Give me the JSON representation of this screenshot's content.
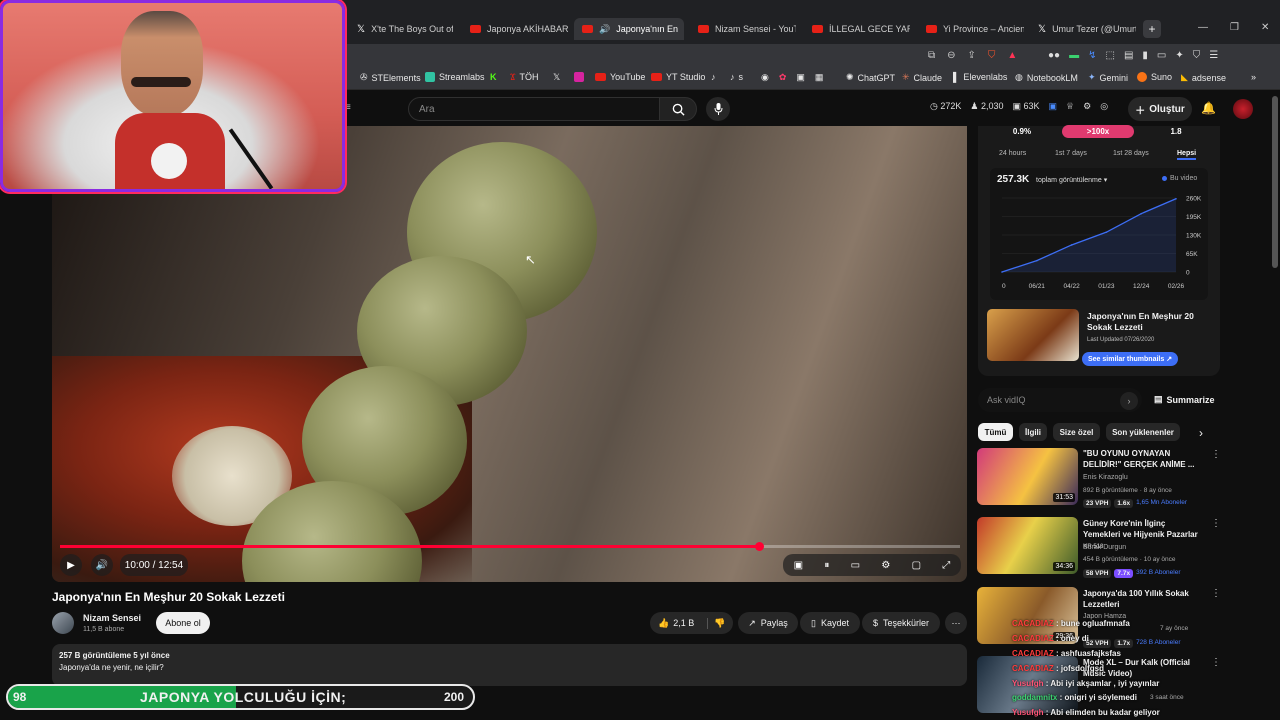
{
  "browser": {
    "tabs": [
      {
        "label": "X'te The Boys Out of C",
        "icon": "x-icon"
      },
      {
        "label": "Japonya AKİHABARA b",
        "icon": "youtube-icon"
      },
      {
        "label": "Japonya'nın En",
        "icon": "youtube-icon",
        "active": true
      },
      {
        "label": "Nizam Sensei - YouTub",
        "icon": "youtube-icon"
      },
      {
        "label": "İLLEGAL GECE YARIŞIN",
        "icon": "youtube-icon"
      },
      {
        "label": "Yi Province – Ancient C",
        "icon": "youtube-icon"
      },
      {
        "label": "Umur Tezer (@Umurte",
        "icon": "x-icon"
      }
    ],
    "new_tab": "+",
    "window_controls": [
      "—",
      "❐",
      "✕"
    ],
    "bookmarks": [
      "STElements",
      "Streamlabs",
      "TÖH",
      "YouTube",
      "YT Studio",
      "s",
      "ChatGPT",
      "Claude",
      "Elevenlabs",
      "NotebookLM",
      "Gemini",
      "Suno",
      "adsense"
    ],
    "more_bookmarks": "»"
  },
  "youtube": {
    "search_placeholder": "Ara",
    "header_stats": {
      "views": "272K",
      "likes": "2,030",
      "subs": "63K"
    },
    "create_label": "Oluştur"
  },
  "video": {
    "time": "10:00 / 12:54",
    "progress": 0.777,
    "title": "Japonya'nın En Meşhur 20 Sokak Lezzeti",
    "channel": "Nizam Sensei",
    "subscribers": "11,5 B abone",
    "subscribe_label": "Abone ol",
    "likes": "2,1 B",
    "share_label": "Paylaş",
    "save_label": "Kaydet",
    "thanks_label": "Teşekkürler",
    "desc_meta": "257 B görüntüleme  5 yıl önce",
    "desc_text": "Japonya'da ne yenir, ne içilir?"
  },
  "vidiq": {
    "stats": [
      "0.9%",
      ">100x",
      "1.8"
    ],
    "ranges": [
      "24 hours",
      "1st 7 days",
      "1st 28 days",
      "Hepsi"
    ],
    "total_views": "257.3K",
    "views_dropdown": "toplam görüntülenme ▾",
    "legend": "Bu video",
    "card_title": "Japonya'nın En Meşhur 20 Sokak Lezzeti",
    "card_updated": "Last Updated 07/26/2020",
    "similar_label": "See similar thumbnails ↗",
    "ask_placeholder": "Ask vidIQ",
    "summarize_label": "Summarize"
  },
  "chart_data": {
    "type": "line",
    "x": [
      "0",
      "06/21",
      "04/22",
      "01/23",
      "12/24",
      "02/26"
    ],
    "ytick_labels": [
      "0",
      "65K",
      "130K",
      "195K",
      "260K"
    ],
    "ylim": [
      0,
      260000
    ],
    "series": [
      {
        "name": "Bu video",
        "values": [
          0,
          40000,
          95000,
          140000,
          205000,
          257300
        ]
      }
    ],
    "color": "#3d6ef5"
  },
  "chips": [
    "Tümü",
    "İlgili",
    "Size özel",
    "Son yüklenenler"
  ],
  "recommendations": [
    {
      "title": "\"BU OYUNU OYNAYAN DELİDİR!\" GERÇEK ANİME ...",
      "channel": "Enis Kirazoglu",
      "meta": "892 B görüntüleme · 8 ay önce",
      "vph": "23 VPH",
      "mult": "1.6x",
      "subs": "1,65 Mn Aboneler",
      "duration": "31:53",
      "colors": [
        "#d23a7a",
        "#f5c242"
      ]
    },
    {
      "title": "Güney Kore'nin İlginç Yemekleri ve Hijyenik Pazarlar",
      "ep": "KR 518",
      "channel": "Burak Durgun",
      "meta": "454 B görüntüleme · 10 ay önce",
      "vph": "58 VPH",
      "mult": "7.7x",
      "subs": "392 B Aboneler",
      "duration": "34:36",
      "colors": [
        "#c23a2a",
        "#3d5a2a"
      ]
    },
    {
      "title": "Japonya'da 100 Yıllık Sokak Lezzetleri",
      "channel": "Japon Hamza",
      "meta": "7 ay önce",
      "vph": "52 VPH",
      "mult": "1.7x",
      "subs": "728 B Aboneler",
      "duration": "29:36",
      "colors": [
        "#e8b23a",
        "#8a5a2a"
      ]
    },
    {
      "title": "Mode XL – Dur Kalk (Official Music Video)",
      "channel": "",
      "meta": "3 saat önce",
      "vph": "",
      "mult": "",
      "subs": "",
      "duration": "",
      "colors": [
        "#2a3a4a",
        "#6a7a8a"
      ]
    }
  ],
  "overlay": {
    "goal_start": "98",
    "goal_text": "JAPONYA YOLCULUĞU İÇİN;",
    "goal_end": "200",
    "goal_fraction": 0.49,
    "chat": [
      {
        "user": "CACADIAZ",
        "msg": "bune ogluafmnafa",
        "color": "#ff3b3b"
      },
      {
        "user": "CACADIAZ",
        "msg": "oney di",
        "color": "#ff3b3b"
      },
      {
        "user": "CACADIAZ",
        "msg": "ashfuasfajksfas",
        "color": "#ff3b3b"
      },
      {
        "user": "CACADIAZ",
        "msg": "jofsdolfgsd",
        "color": "#ff3b3b"
      },
      {
        "user": "Yusufgh",
        "msg": "Abi iyi akşamlar , iyi yayınlar",
        "color": "#ff5577"
      },
      {
        "user": "goddamnitx",
        "msg": "onigri yi söylemedi",
        "color": "#3bd16f"
      },
      {
        "user": "Yusufgh",
        "msg": "Abi elimden bu kadar geliyor",
        "color": "#ff5577"
      }
    ]
  }
}
